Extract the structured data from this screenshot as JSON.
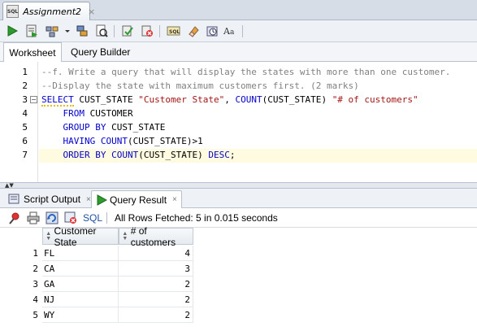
{
  "window": {
    "tab_title": "Assignment2",
    "tab_close": "×"
  },
  "editor_tabs": {
    "worksheet": "Worksheet",
    "query_builder": "Query Builder"
  },
  "editor": {
    "line_numbers": [
      "1",
      "2",
      "3",
      "4",
      "5",
      "6",
      "7"
    ],
    "lines": [
      "--f. Write a query that will display the states with more than one customer.",
      "--Display the state with maximum customers first. (2 marks)",
      "SELECT CUST_STATE \"Customer State\", COUNT(CUST_STATE) \"# of customers\"",
      "    FROM CUSTOMER",
      "    GROUP BY CUST_STATE",
      "    HAVING COUNT(CUST_STATE)>1",
      "    ORDER BY COUNT(CUST_STATE) DESC;"
    ]
  },
  "output_tabs": {
    "script_output": "Script Output",
    "query_result": "Query Result",
    "close": "×"
  },
  "result_toolbar": {
    "sql_label": "SQL",
    "status": "All Rows Fetched: 5 in 0.015 seconds"
  },
  "grid": {
    "columns": [
      "Customer State",
      "# of customers"
    ],
    "rows": [
      {
        "n": "1",
        "state": "FL",
        "count": "4"
      },
      {
        "n": "2",
        "state": "CA",
        "count": "3"
      },
      {
        "n": "3",
        "state": "GA",
        "count": "2"
      },
      {
        "n": "4",
        "state": "NJ",
        "count": "2"
      },
      {
        "n": "5",
        "state": "WY",
        "count": "2"
      }
    ]
  },
  "colors": {
    "keyword": "#0000cc",
    "comment": "#808080",
    "string": "#a31515",
    "current_line": "#fffbe0"
  }
}
